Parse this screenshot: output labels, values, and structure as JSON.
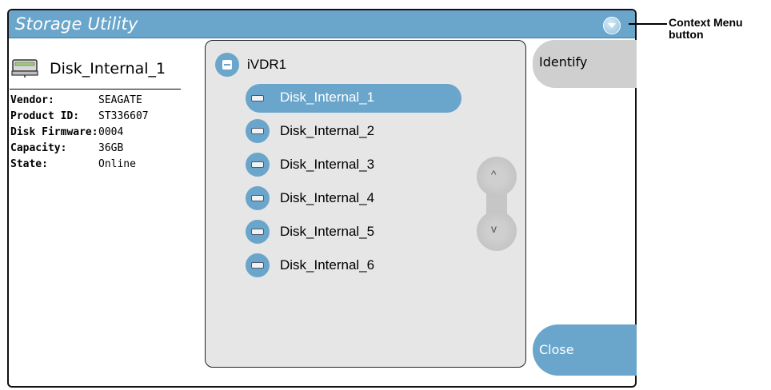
{
  "window": {
    "title": "Storage Utility",
    "context_menu_icon": "chevron-down-icon"
  },
  "disk_info": {
    "icon": "hard-drive-icon",
    "name": "Disk_Internal_1",
    "properties": [
      {
        "key": "Vendor:",
        "value": "SEAGATE"
      },
      {
        "key": "Product ID:",
        "value": "ST336607"
      },
      {
        "key": "Disk Firmware:",
        "value": "0004"
      },
      {
        "key": "Capacity:",
        "value": "36GB"
      },
      {
        "key": "State:",
        "value": "Online"
      }
    ]
  },
  "tree": {
    "root": {
      "label": "iVDR1",
      "expanded": true,
      "icon": "collapse-icon"
    },
    "items": [
      {
        "label": "Disk_Internal_1",
        "selected": true,
        "icon": "hard-drive-icon"
      },
      {
        "label": "Disk_Internal_2",
        "selected": false,
        "icon": "hard-drive-icon"
      },
      {
        "label": "Disk_Internal_3",
        "selected": false,
        "icon": "hard-drive-icon"
      },
      {
        "label": "Disk_Internal_4",
        "selected": false,
        "icon": "hard-drive-icon"
      },
      {
        "label": "Disk_Internal_5",
        "selected": false,
        "icon": "hard-drive-icon"
      },
      {
        "label": "Disk_Internal_6",
        "selected": false,
        "icon": "hard-drive-icon"
      }
    ],
    "scroll": {
      "up": "^",
      "down": "v"
    }
  },
  "buttons": {
    "identify": "Identify",
    "close": "Close"
  },
  "callout": {
    "line1": "Context Menu",
    "line2": "button"
  },
  "colors": {
    "accent": "#6aa6cc",
    "panel": "#e6e6e6",
    "tab_gray": "#cfcfcf"
  }
}
